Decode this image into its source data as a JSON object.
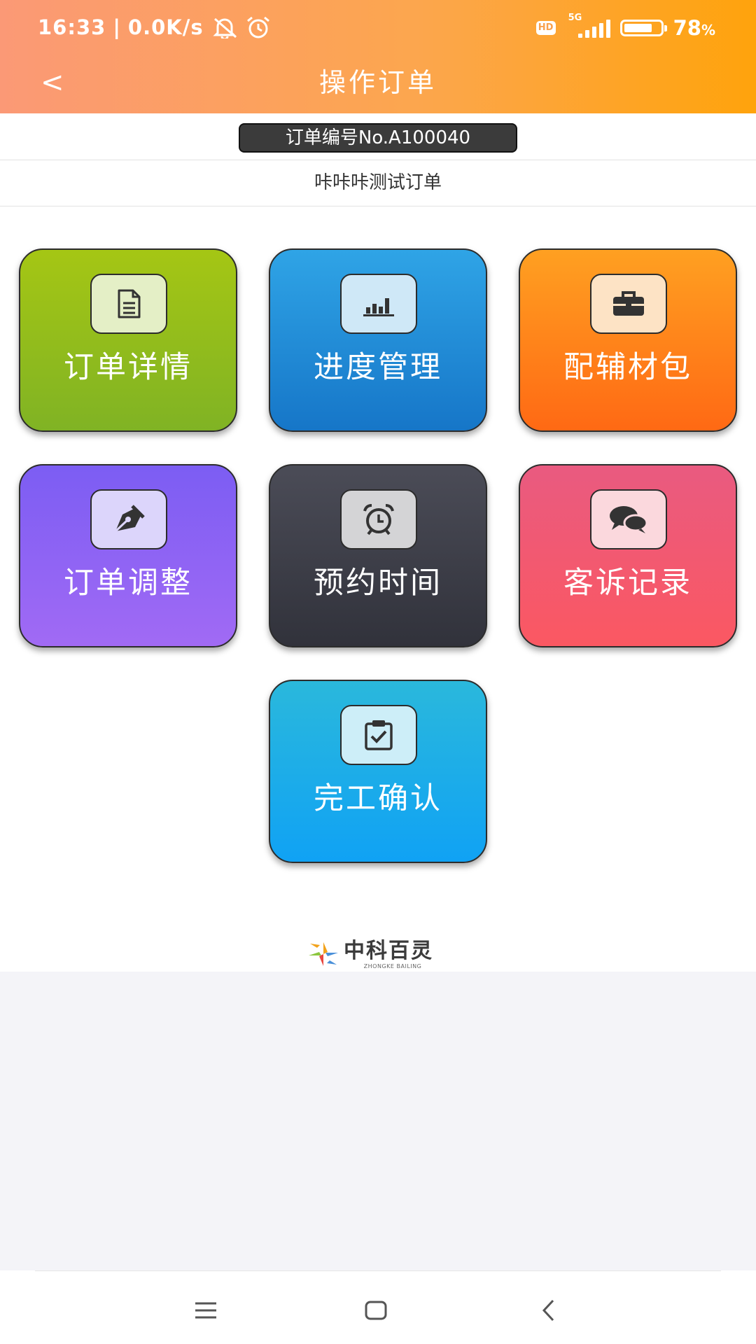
{
  "status_bar": {
    "time": "16:33",
    "separator": "|",
    "network_speed": "0.0K/s",
    "hd_badge": "HD",
    "network_type": "5G",
    "battery_level": 0.78,
    "battery_percent": "78",
    "battery_unit": "%"
  },
  "header": {
    "back_label": "<",
    "title": "操作订单"
  },
  "order": {
    "number_label": "订单编号No.A100040",
    "name": "咔咔咔测试订单"
  },
  "tiles": [
    {
      "label": "订单详情",
      "icon": "document-icon",
      "color": "#8fbb1c"
    },
    {
      "label": "进度管理",
      "icon": "bar-chart-icon",
      "color": "#1f8fd8"
    },
    {
      "label": "配辅材包",
      "icon": "briefcase-icon",
      "color": "#ff841a"
    },
    {
      "label": "订单调整",
      "icon": "pen-nib-icon",
      "color": "#8d63f3"
    },
    {
      "label": "预约时间",
      "icon": "alarm-clock-icon",
      "color": "#3e3f49"
    },
    {
      "label": "客诉记录",
      "icon": "chat-bubbles-icon",
      "color": "#f15a70"
    },
    {
      "label": "完工确认",
      "icon": "clipboard-check-icon",
      "color": "#1cadea"
    }
  ],
  "footer": {
    "logo_name": "中科百灵",
    "logo_sub": "ZHONGKE BAILING"
  },
  "system_nav": {
    "icons": [
      "menu-icon",
      "home-square-icon",
      "back-chevron-icon"
    ]
  }
}
